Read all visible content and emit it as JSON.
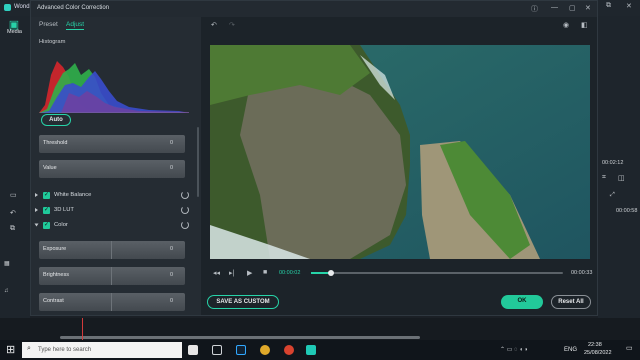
{
  "background_app": {
    "title": "Wond",
    "media_tab": "Media",
    "right_time_top": "00:02:12",
    "right_time_bottom": "00:00:58"
  },
  "dialog": {
    "title": "Advanced Color Correction",
    "tabs": [
      {
        "label": "Preset",
        "active": false
      },
      {
        "label": "Adjust",
        "active": true
      }
    ],
    "histogram_label": "Histogram",
    "auto_button": "Auto",
    "top_sliders": [
      {
        "label": "Threshold",
        "value": "0"
      },
      {
        "label": "Value",
        "value": "0"
      }
    ],
    "sections": [
      {
        "label": "White Balance",
        "checked": true
      },
      {
        "label": "3D LUT",
        "checked": true
      },
      {
        "label": "Color",
        "checked": true
      }
    ],
    "color_sliders": [
      {
        "label": "Exposure",
        "value": "0"
      },
      {
        "label": "Brightness",
        "value": "0"
      },
      {
        "label": "Contrast",
        "value": "0"
      }
    ],
    "playback": {
      "current_time": "00:00:02",
      "total_time": "00:00:33",
      "progress": 0.08
    },
    "buttons": {
      "save_custom": "SAVE AS CUSTOM",
      "ok": "OK",
      "reset_all": "Reset All"
    }
  },
  "taskbar": {
    "search_placeholder": "Type here to search",
    "language": "ENG",
    "time": "22:38",
    "date": "25/08/2022"
  },
  "colors": {
    "accent": "#27d3a8",
    "ok_button": "#22c99a"
  }
}
